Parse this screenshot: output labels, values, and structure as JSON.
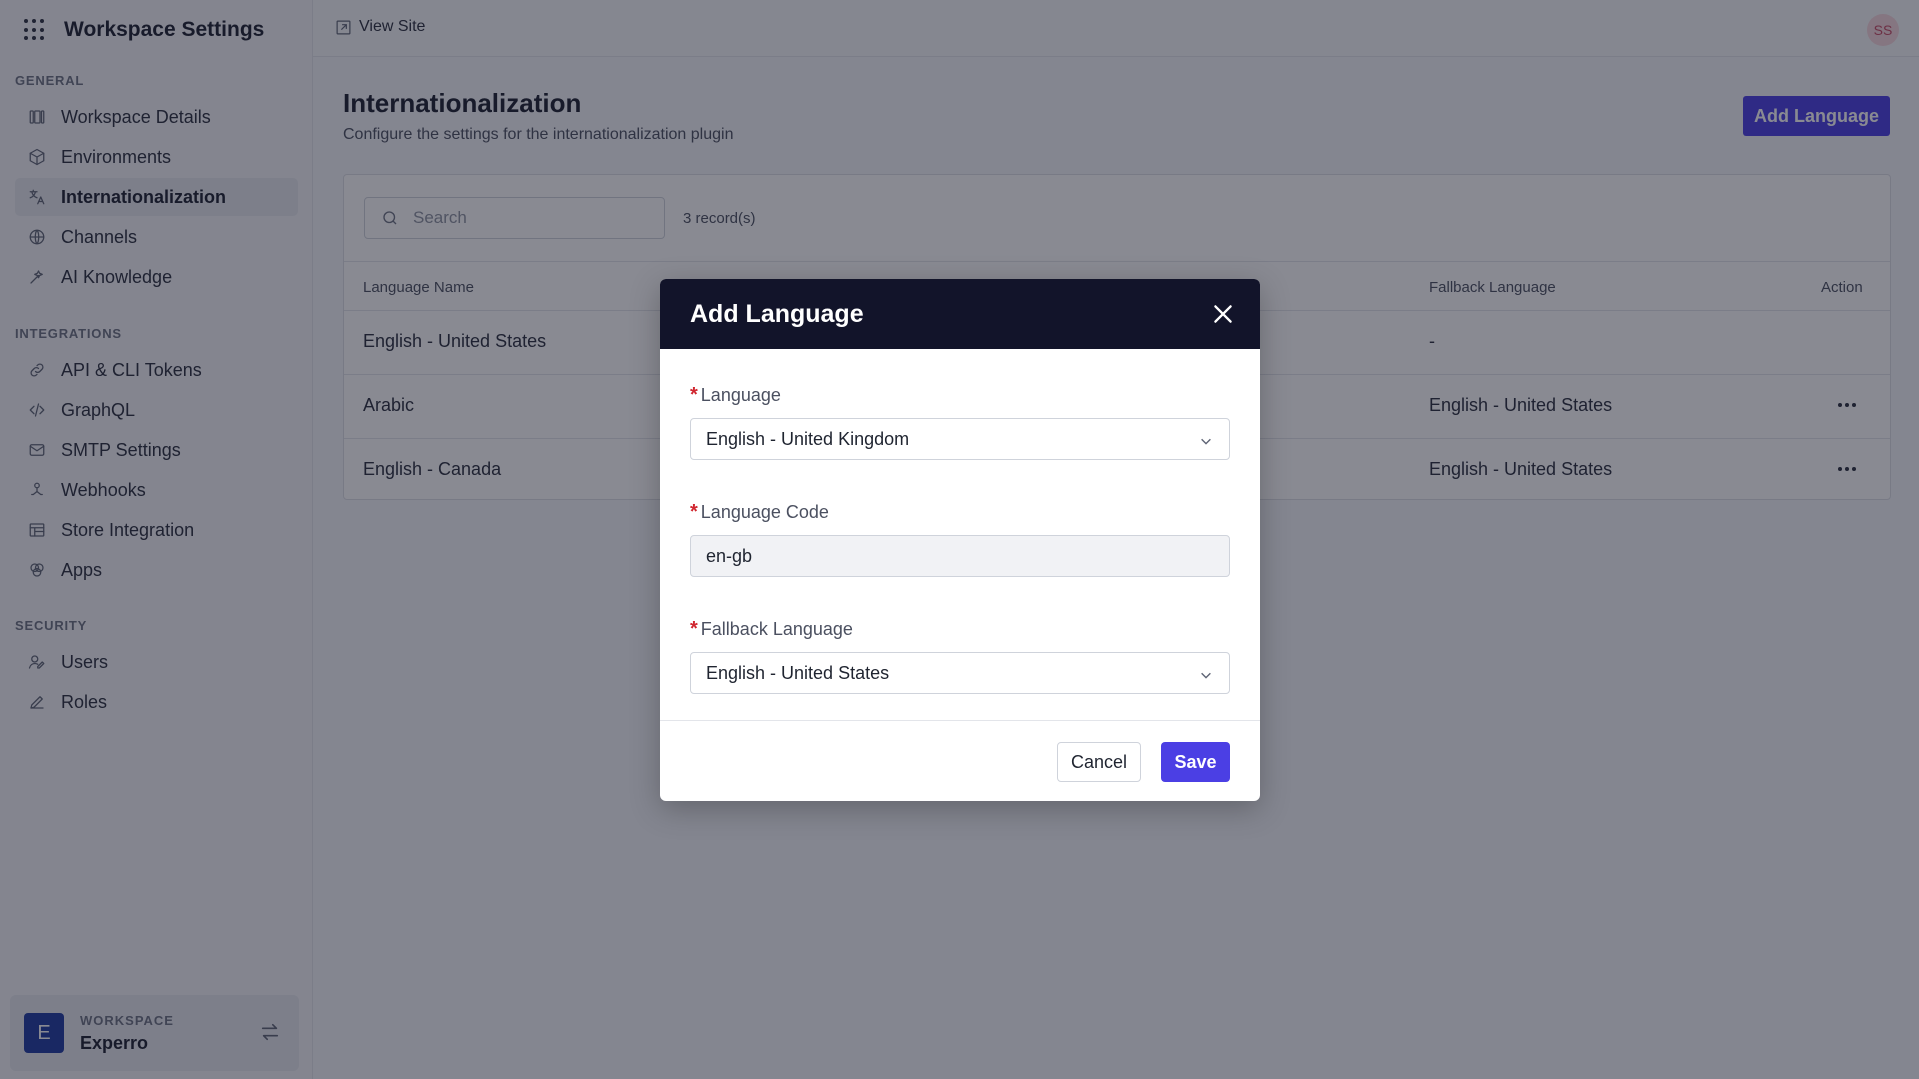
{
  "app": {
    "title": "Workspace Settings",
    "menu_icon": "apps-grid-icon"
  },
  "sidebar": {
    "sections": [
      {
        "label": "GENERAL",
        "items": [
          {
            "label": "Workspace Details",
            "icon": "layout-icon"
          },
          {
            "label": "Environments",
            "icon": "cube-icon"
          },
          {
            "label": "Internationalization",
            "icon": "translate-icon",
            "active": true
          },
          {
            "label": "Channels",
            "icon": "globe-icon"
          },
          {
            "label": "AI Knowledge",
            "icon": "sparkle-icon"
          }
        ]
      },
      {
        "label": "INTEGRATIONS",
        "items": [
          {
            "label": "API & CLI Tokens",
            "icon": "link-icon"
          },
          {
            "label": "GraphQL",
            "icon": "code-icon"
          },
          {
            "label": "SMTP Settings",
            "icon": "mail-icon"
          },
          {
            "label": "Webhooks",
            "icon": "webhook-icon"
          },
          {
            "label": "Store Integration",
            "icon": "store-icon"
          },
          {
            "label": "Apps",
            "icon": "apps-icon"
          }
        ]
      },
      {
        "label": "SECURITY",
        "items": [
          {
            "label": "Users",
            "icon": "users-icon"
          },
          {
            "label": "Roles",
            "icon": "pen-icon"
          }
        ]
      }
    ],
    "workspace": {
      "label": "WORKSPACE",
      "name": "Experro",
      "avatar": "E"
    }
  },
  "topbar": {
    "view_site": "View Site",
    "user_initials": "SS"
  },
  "main": {
    "title": "Internationalization",
    "subtitle": "Configure the settings for the internationalization plugin",
    "add_button": "Add Language",
    "search_placeholder": "Search",
    "records": "3 record(s)",
    "columns": {
      "language_name": "Language Name",
      "fallback_language": "Fallback Language",
      "action": "Action"
    },
    "rows": [
      {
        "language_name": "English - United States",
        "fallback_language": "-",
        "has_action": false
      },
      {
        "language_name": "Arabic",
        "fallback_language": "English - United States",
        "has_action": true
      },
      {
        "language_name": "English - Canada",
        "fallback_language": "English - United States",
        "has_action": true
      }
    ]
  },
  "modal": {
    "title": "Add Language",
    "fields": {
      "language": {
        "label": "Language",
        "value": "English - United Kingdom"
      },
      "language_code": {
        "label": "Language Code",
        "value": "en-gb"
      },
      "fallback_language": {
        "label": "Fallback Language",
        "value": "English - United States"
      }
    },
    "required_marker": "*",
    "cancel_label": "Cancel",
    "save_label": "Save"
  },
  "colors": {
    "primary": "#4b3fe4",
    "modal_header": "#12142a",
    "required": "#d0262f"
  }
}
